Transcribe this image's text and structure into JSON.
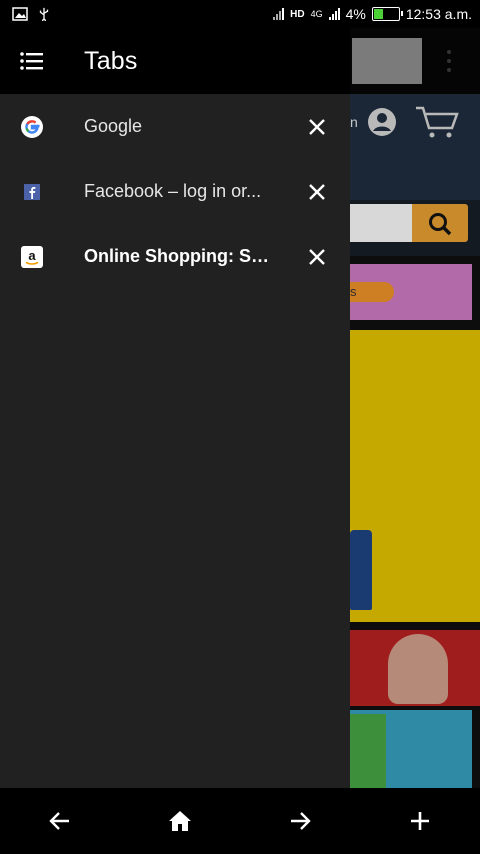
{
  "status_bar": {
    "battery_text": "4%",
    "time": "12:53 a.m.",
    "network": "4G",
    "hd": "HD",
    "battery_level": 0.4
  },
  "drawer": {
    "title": "Tabs",
    "tabs": [
      {
        "title": "Google",
        "favicon": "google-icon",
        "active": false
      },
      {
        "title": "Facebook – log in or...",
        "favicon": "facebook-icon",
        "active": false
      },
      {
        "title": "Online Shopping: Sh...",
        "favicon": "amazon-icon",
        "active": true
      }
    ]
  },
  "background_page": {
    "signin_fragment": "n",
    "promo_fragment": "s"
  },
  "colors": {
    "drawer_bg": "#212121",
    "header_bg": "#000000",
    "search_button": "#c98a2c"
  }
}
